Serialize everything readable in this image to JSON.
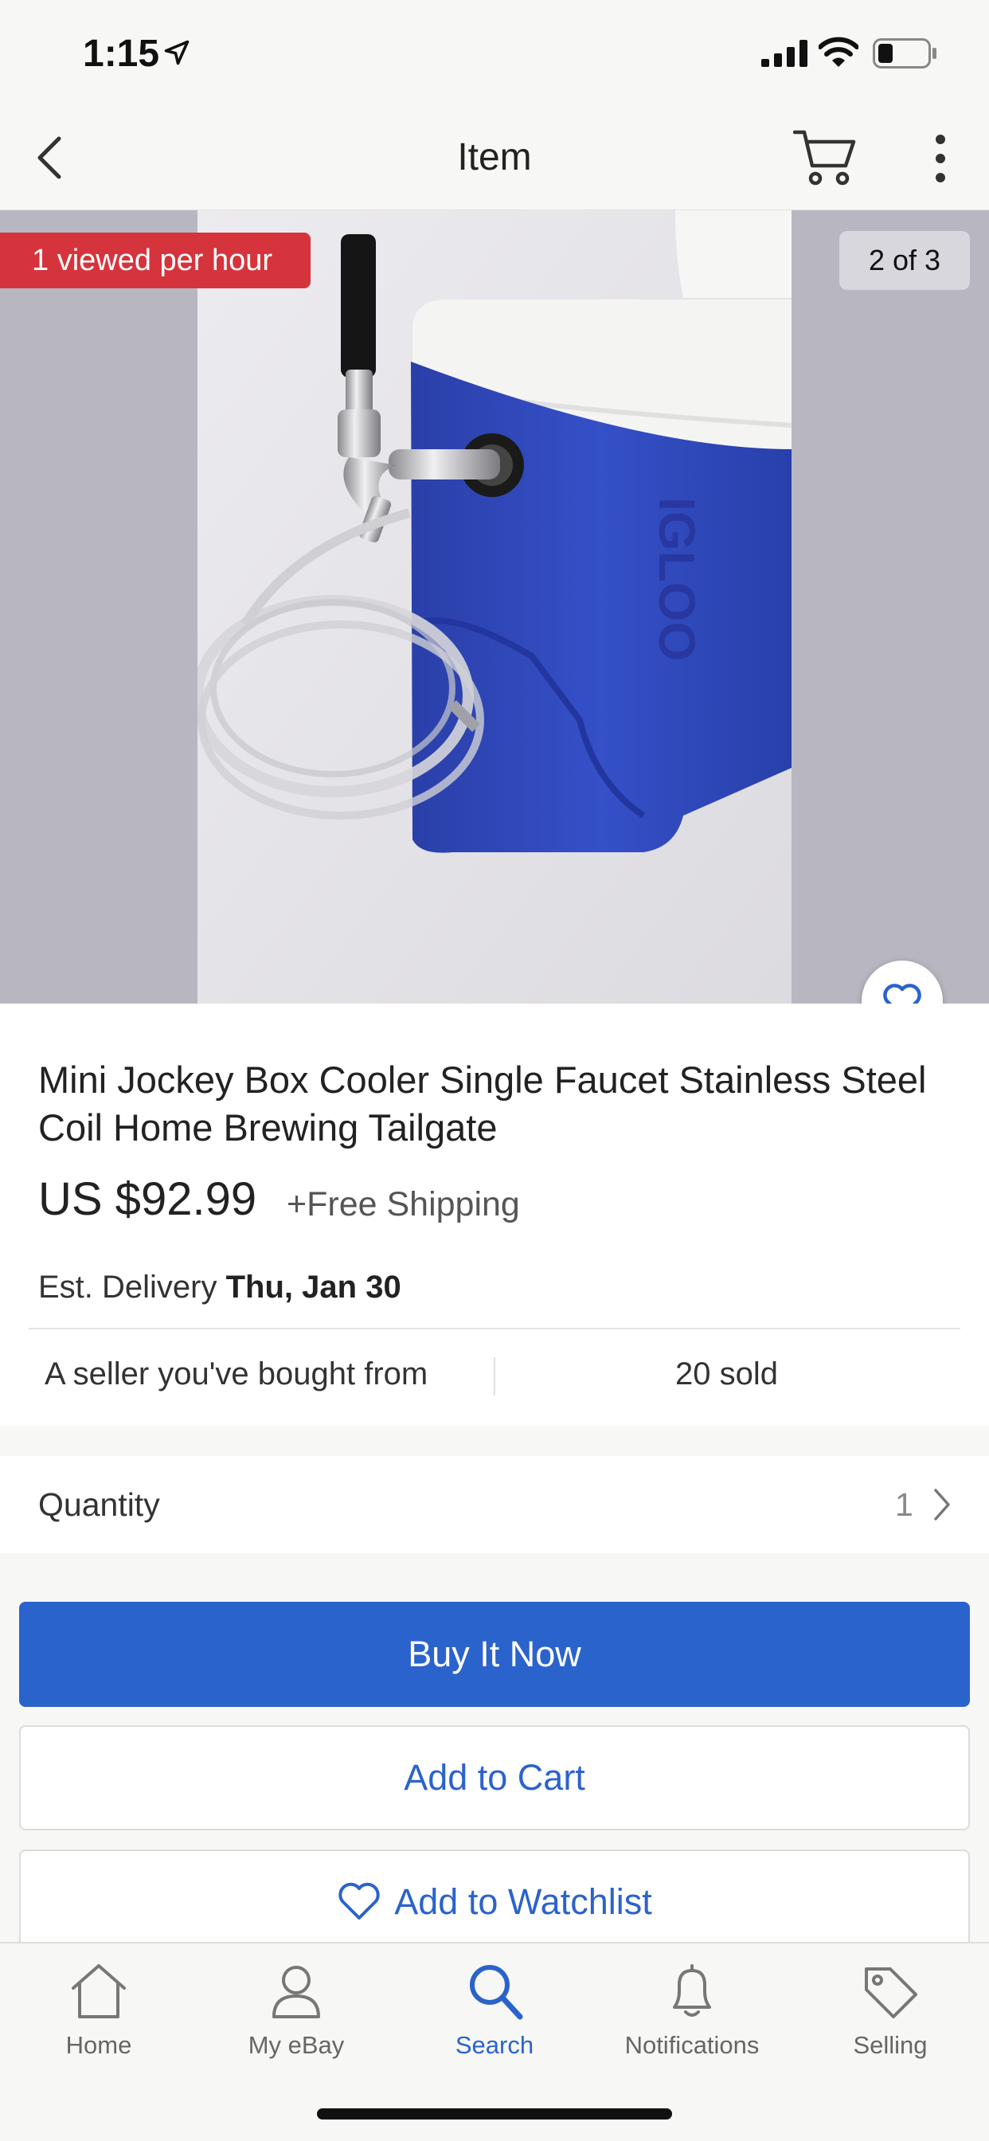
{
  "status_bar": {
    "time": "1:15"
  },
  "nav": {
    "title": "Item",
    "back_icon": "chevron-left-icon",
    "cart_icon": "cart-icon",
    "more_icon": "more-vertical-icon"
  },
  "gallery": {
    "viewed_badge": "1 viewed per hour",
    "page_indicator": "2 of 3",
    "photo_brand_text": "IGLOO"
  },
  "item": {
    "title": "Mini Jockey Box Cooler Single Faucet Stainless Steel Coil Home Brewing Tailgate",
    "price": "US $92.99",
    "shipping": "+Free Shipping",
    "delivery_label": "Est. Delivery",
    "delivery_date": "Thu, Jan 30",
    "seller_note": "A seller you've bought from",
    "sold_count": "20 sold"
  },
  "quantity": {
    "label": "Quantity",
    "value": "1"
  },
  "actions": {
    "buy_now": "Buy It Now",
    "add_to_cart": "Add to Cart",
    "add_to_watchlist": "Add to Watchlist"
  },
  "tabs": [
    {
      "label": "Home",
      "icon": "home-icon",
      "active": false
    },
    {
      "label": "My eBay",
      "icon": "user-icon",
      "active": false
    },
    {
      "label": "Search",
      "icon": "search-icon",
      "active": true
    },
    {
      "label": "Notifications",
      "icon": "bell-icon",
      "active": false
    },
    {
      "label": "Selling",
      "icon": "tag-icon",
      "active": false
    }
  ],
  "colors": {
    "accent": "#2b63cc",
    "badge_red": "#d6343c",
    "cooler_blue": "#2f4bbf"
  }
}
